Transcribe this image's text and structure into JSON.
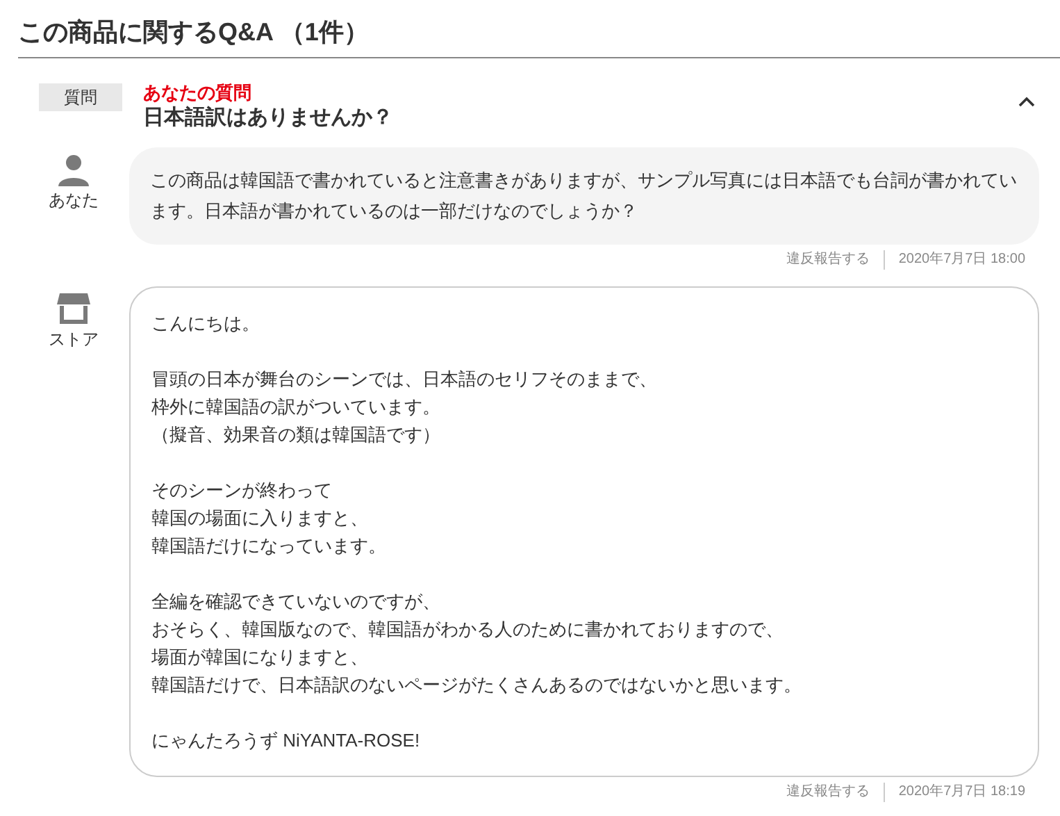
{
  "heading": "この商品に関するQ&A （1件）",
  "question": {
    "tag": "質問",
    "label": "あなたの質問",
    "title": "日本語訳はありませんか？",
    "expanded": true
  },
  "messages": [
    {
      "kind": "question",
      "author": "あなた",
      "paragraphs": [
        [
          "この商品は韓国語で書かれていると注意書きがありますが、サンプル写真には日本語でも台詞が書かれています。日本語が書かれているのは一部だけなのでしょうか？"
        ]
      ],
      "report": "違反報告する",
      "date": "2020年7月7日 18:00"
    },
    {
      "kind": "answer",
      "author": "ストア",
      "paragraphs": [
        [
          "こんにちは。"
        ],
        [
          "冒頭の日本が舞台のシーンでは、日本語のセリフそのままで、",
          "枠外に韓国語の訳がついています。",
          "（擬音、効果音の類は韓国語です）"
        ],
        [
          "そのシーンが終わって",
          "韓国の場面に入りますと、",
          "韓国語だけになっています。"
        ],
        [
          "全編を確認できていないのですが、",
          "おそらく、韓国版なので、韓国語がわかる人のために書かれておりますので、",
          "場面が韓国になりますと、",
          "韓国語だけで、日本語訳のないページがたくさんあるのではないかと思います。"
        ],
        [
          "にゃんたろうず NiYANTA-ROSE!"
        ]
      ],
      "report": "違反報告する",
      "date": "2020年7月7日 18:19"
    }
  ]
}
